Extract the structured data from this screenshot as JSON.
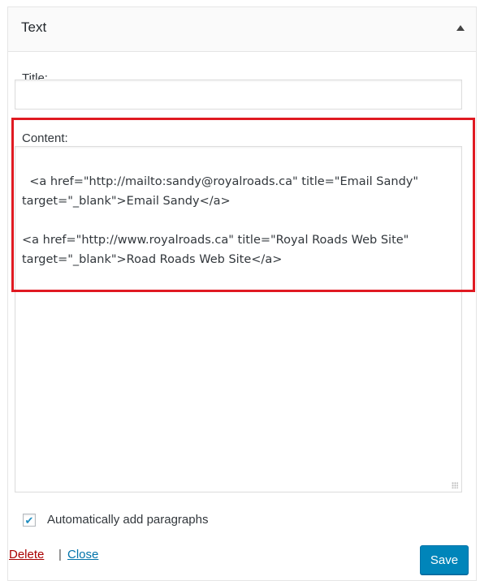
{
  "widget": {
    "title": "Text"
  },
  "form": {
    "title_label": "Title:",
    "title_value": "",
    "content_label": "Content:",
    "content_value": "<a href=\"http://mailto:sandy@royalroads.ca\" title=\"Email Sandy\"\ntarget=\"_blank\">Email Sandy</a>\n\n<a href=\"http://www.royalroads.ca\" title=\"Royal Roads Web Site\"\ntarget=\"_blank\">Road Roads Web Site</a>",
    "autop_label": "Automatically add paragraphs",
    "autop_checked": true
  },
  "actions": {
    "delete_label": "Delete",
    "separator": "|",
    "close_label": "Close",
    "save_label": "Save"
  },
  "colors": {
    "highlight": "#e01a22",
    "save_button": "#0085ba",
    "delete_link": "#aa0000",
    "close_link": "#0073aa"
  }
}
